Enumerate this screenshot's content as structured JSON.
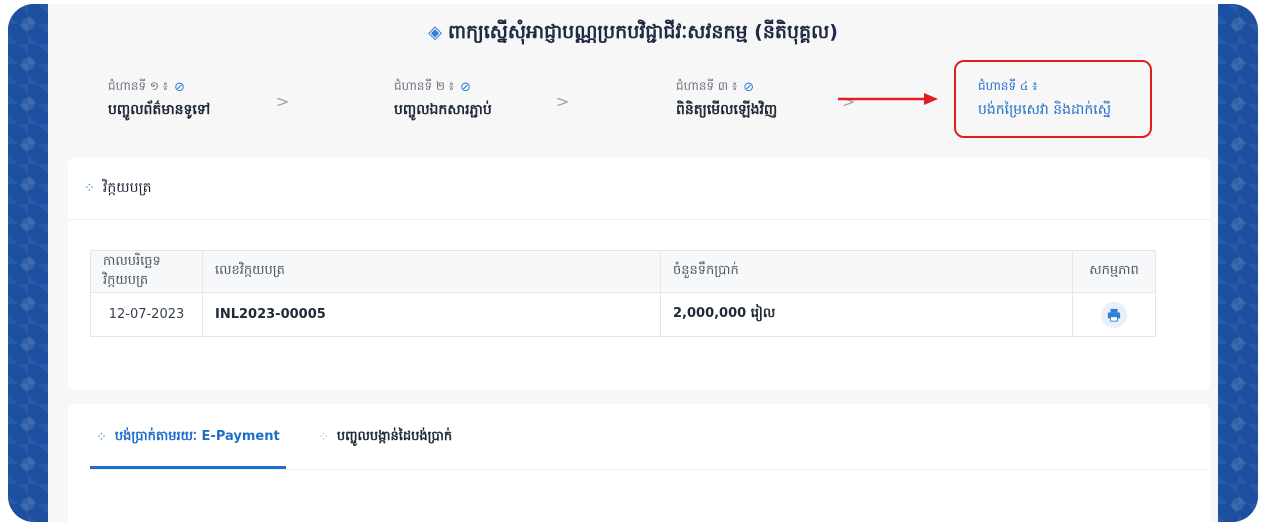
{
  "header": {
    "title": "ពាក្យស្នើសុំអាជ្ញាបណ្ណប្រកបវិជ្ជាជីវៈសវនកម្ម (នីតិបុគ្គល)"
  },
  "steps": [
    {
      "sub": "ជំហានទី ១ ៖",
      "label": "បញ្ចូលព័ត៌មានទូទៅ",
      "done": true
    },
    {
      "sub": "ជំហានទី ២ ៖",
      "label": "បញ្ចូលឯកសារភ្ជាប់",
      "done": true
    },
    {
      "sub": "ជំហានទី ៣ ៖",
      "label": "ពិនិត្យមើលឡើងវិញ",
      "done": true
    },
    {
      "sub": "ជំហានទី ៤ ៖",
      "label": "បង់កម្រៃសេវា និងដាក់ស្នើ",
      "done": false,
      "active": true
    }
  ],
  "invoice": {
    "section_label": "វិក្កយបត្រ",
    "columns": [
      "កាលបរិច្ឆេទវិក្កយបត្រ",
      "លេខវិក្កយបត្រ",
      "ចំនួនទឹកប្រាក់",
      "សកម្មភាព"
    ],
    "rows": [
      {
        "date": "12-07-2023",
        "number": "INL2023-00005",
        "amount": "2,000,000 រៀល"
      }
    ]
  },
  "payment": {
    "tabs": [
      {
        "label": "បង់ប្រាក់តាមរយៈ E-Payment",
        "active": true
      },
      {
        "label": "បញ្ចូលបង្កាន់ដៃបង់ប្រាក់",
        "active": false
      }
    ]
  },
  "colors": {
    "primary": "#1f6fc9",
    "highlight": "#e11d1d",
    "frame": "#1c4fa0"
  }
}
